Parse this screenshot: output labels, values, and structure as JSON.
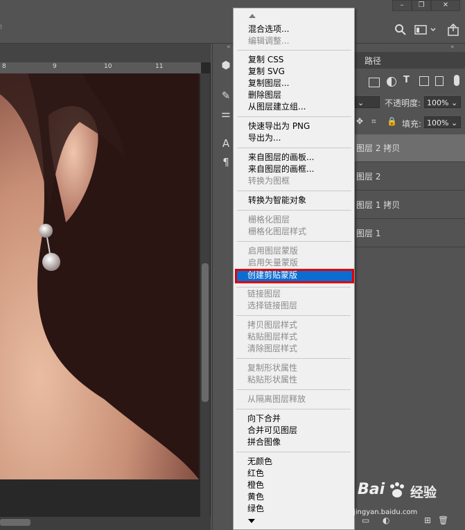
{
  "colors": {
    "menu_bg": "#f0f0f0",
    "highlight": "#0b6cd1",
    "red_box": "#e20000",
    "ui_bg": "#535353"
  },
  "window_buttons": [
    "minimize-icon",
    "restore-icon",
    "close-icon"
  ],
  "options_bar": {
    "search_icon": "search-icon",
    "workspace_icon": "workspace-icon",
    "share_icon": "share-icon"
  },
  "ruler": {
    "ticks": [
      "8",
      "9",
      "10",
      "11"
    ]
  },
  "tools": [
    "3d-icon",
    "brush-settings-icon",
    "adjust-icon",
    "type-a-icon",
    "paragraph-icon"
  ],
  "panel": {
    "tab_paths": "路径",
    "opacity_label": "不透明度:",
    "opacity_value": "100%",
    "fill_label": "填充:",
    "fill_value": "100%",
    "layers": [
      {
        "name": "图层 2 拷贝",
        "selected": true
      },
      {
        "name": "图层 2",
        "selected": false
      },
      {
        "name": "图层 1 拷贝",
        "selected": false
      },
      {
        "name": "图层 1",
        "selected": false
      }
    ]
  },
  "menu": {
    "items": [
      {
        "label": "混合选项...",
        "disabled": false
      },
      {
        "label": "编辑调整...",
        "disabled": true
      },
      {
        "label": "复制 CSS",
        "disabled": false
      },
      {
        "label": "复制 SVG",
        "disabled": false
      },
      {
        "label": "复制图层...",
        "disabled": false
      },
      {
        "label": "删除图层",
        "disabled": false
      },
      {
        "label": "从图层建立组...",
        "disabled": false
      },
      {
        "label": "快速导出为 PNG",
        "disabled": false
      },
      {
        "label": "导出为...",
        "disabled": false
      },
      {
        "label": "来自图层的画板...",
        "disabled": false
      },
      {
        "label": "来自图层的画框...",
        "disabled": false
      },
      {
        "label": "转换为图框",
        "disabled": true
      },
      {
        "label": "转换为智能对象",
        "disabled": false
      },
      {
        "label": "栅格化图层",
        "disabled": true
      },
      {
        "label": "栅格化图层样式",
        "disabled": true
      },
      {
        "label": "启用图层蒙版",
        "disabled": true
      },
      {
        "label": "启用矢量蒙版",
        "disabled": true
      },
      {
        "label": "创建剪贴蒙版",
        "disabled": false,
        "highlighted": true
      },
      {
        "label": "链接图层",
        "disabled": true
      },
      {
        "label": "选择链接图层",
        "disabled": true
      },
      {
        "label": "拷贝图层样式",
        "disabled": true
      },
      {
        "label": "粘贴图层样式",
        "disabled": true
      },
      {
        "label": "清除图层样式",
        "disabled": true
      },
      {
        "label": "复制形状属性",
        "disabled": true
      },
      {
        "label": "粘贴形状属性",
        "disabled": true
      },
      {
        "label": "从隔离图层释放",
        "disabled": true
      },
      {
        "label": "向下合并",
        "disabled": false
      },
      {
        "label": "合并可见图层",
        "disabled": false
      },
      {
        "label": "拼合图像",
        "disabled": false
      },
      {
        "label": "无颜色",
        "disabled": false
      },
      {
        "label": "红色",
        "disabled": false
      },
      {
        "label": "橙色",
        "disabled": false
      },
      {
        "label": "黄色",
        "disabled": false
      },
      {
        "label": "绿色",
        "disabled": false
      }
    ]
  },
  "watermark": {
    "brand": "Bai",
    "brand_suffix": "经验",
    "url": "jingyan.baidu.com"
  }
}
